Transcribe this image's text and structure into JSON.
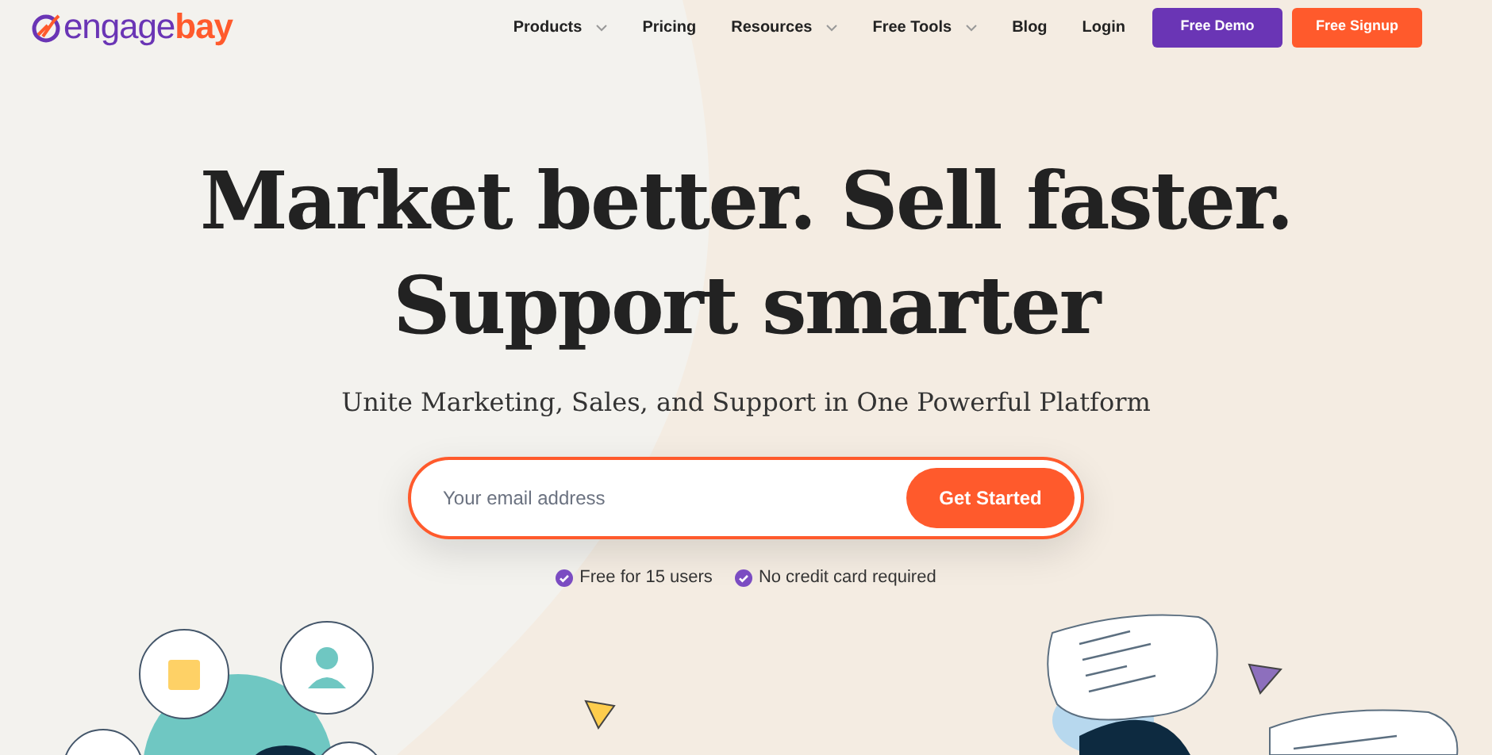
{
  "logo": {
    "text": "engage",
    "accent": "bay"
  },
  "nav": [
    {
      "label": "Products",
      "has_dropdown": true
    },
    {
      "label": "Pricing",
      "has_dropdown": false
    },
    {
      "label": "Resources",
      "has_dropdown": true
    },
    {
      "label": "Free Tools",
      "has_dropdown": true
    },
    {
      "label": "Blog",
      "has_dropdown": false
    },
    {
      "label": "Login",
      "has_dropdown": false
    }
  ],
  "nav_buttons": [
    {
      "label": "Free Demo",
      "kind": "demo"
    },
    {
      "label": "Free Signup",
      "kind": "signup"
    }
  ],
  "hero": {
    "headline_lines": [
      "Market better. Sell faster.",
      "Support smarter"
    ],
    "subheadline": "Unite Marketing, Sales, and Support in One Powerful Platform",
    "email": {
      "placeholder": "Your email address"
    },
    "cta": "Get Started",
    "perks": [
      "Free for 15 users",
      "No credit card required"
    ]
  }
}
